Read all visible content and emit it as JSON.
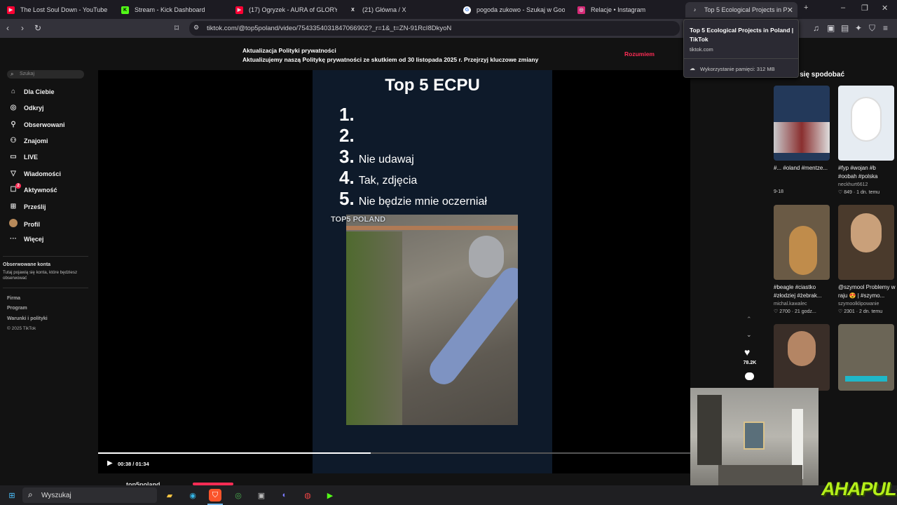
{
  "browser": {
    "tabs": [
      {
        "title": "The Lost Soul Down - YouTube M",
        "color": "#ff0033",
        "glyph": "▶"
      },
      {
        "title": "Stream - Kick Dashboard",
        "color": "#53fc18",
        "glyph": "K"
      },
      {
        "title": "(17) Ogryzek - AURA of GLORY (Offic",
        "color": "#ff0033",
        "glyph": "▶"
      },
      {
        "title": "(21) Główna / X",
        "color": "#000000",
        "glyph": "X"
      },
      {
        "title": "pogoda zukowo - Szukaj w Google",
        "color": "#4285f4",
        "glyph": "G"
      },
      {
        "title": "Relacje • Instagram",
        "color": "#d62976",
        "glyph": "◎"
      },
      {
        "title": "Top 5 Ecological Projects in Pola",
        "color": "#000000",
        "glyph": "♪"
      }
    ],
    "url": "tiktok.com/@top5poland/video/7543354031847066902?_r=1&_t=ZN-91RcI8DkyoN",
    "popup": {
      "title": "Top 5 Ecological Projects in Poland | TikTok",
      "domain": "tiktok.com",
      "memory": "Wykorzystanie pamięci: 312 MB"
    }
  },
  "notice": {
    "title": "Aktualizacja Polityki prywatności",
    "text": "Aktualizujemy naszą Politykę prywatności ze skutkiem od 30 listopada 2025 r. Przejrzyj kluczowe zmiany",
    "button": "Rozumiem"
  },
  "sidebar": {
    "search_placeholder": "Szukaj",
    "items": [
      {
        "label": "Dla Ciebie",
        "icon": "home-icon"
      },
      {
        "label": "Odkryj",
        "icon": "compass-icon"
      },
      {
        "label": "Obserwowani",
        "icon": "user-follow-icon"
      },
      {
        "label": "Znajomi",
        "icon": "friends-icon"
      },
      {
        "label": "LIVE",
        "icon": "live-icon"
      },
      {
        "label": "Wiadomości",
        "icon": "messages-icon"
      },
      {
        "label": "Aktywność",
        "icon": "activity-icon"
      },
      {
        "label": "Prześlij",
        "icon": "upload-icon"
      },
      {
        "label": "Profil",
        "icon": "avatar-icon"
      },
      {
        "label": "Więcej",
        "icon": "more-icon"
      }
    ],
    "activity_badge": "2",
    "followed_title": "Obserwowane konta",
    "followed_desc": "Tutaj pojawią się konta, które będziesz obserwować",
    "footer": [
      "Firma",
      "Program",
      "Warunki i polityki",
      "© 2025 TikTok"
    ]
  },
  "video": {
    "title": "Top 5 ECPU",
    "items": [
      {
        "num": "1.",
        "text": ""
      },
      {
        "num": "2.",
        "text": ""
      },
      {
        "num": "3.",
        "text": "Nie udawaj"
      },
      {
        "num": "4.",
        "text": "Tak, zdjęcia"
      },
      {
        "num": "5.",
        "text": "Nie będzie mnie oczerniał"
      }
    ],
    "watermark": "TOP5 POLAND",
    "time": "00:38 / 01:34",
    "progress": 0.46,
    "author": "top5poland",
    "likes": "78.2K"
  },
  "suggested": {
    "title": "e Ci się spodobać",
    "items": [
      {
        "caption": "#... #oland #mentze...",
        "user": "",
        "stats": "9-18",
        "color": "#23395a"
      },
      {
        "caption": "#fyp #wojan #b #oobah #polska",
        "user": "neckhurt6612",
        "stats": "♡ 849 · 1 dn. temu",
        "color": "#e6ecf2"
      },
      {
        "caption": "#beagle #ciastko #złodziej #żebrak...",
        "user": "michal.kawalec",
        "stats": "♡ 2700 · 21 godz...",
        "color": "#6a5a45"
      },
      {
        "caption": "@szymool Problemy w raju 😍 | #szymo...",
        "user": "szymoolklipowanie",
        "stats": "♡ 2301 · 2 dn. temu",
        "color": "#4a3a2c"
      },
      {
        "caption": "",
        "user": "",
        "stats": "",
        "color": "#3a2e28"
      },
      {
        "caption": "",
        "user": "",
        "stats": "",
        "color": "#6b6556"
      }
    ]
  },
  "taskbar": {
    "search": "Wyszukaj"
  },
  "overlay": {
    "logo": "AHAPULCO"
  }
}
